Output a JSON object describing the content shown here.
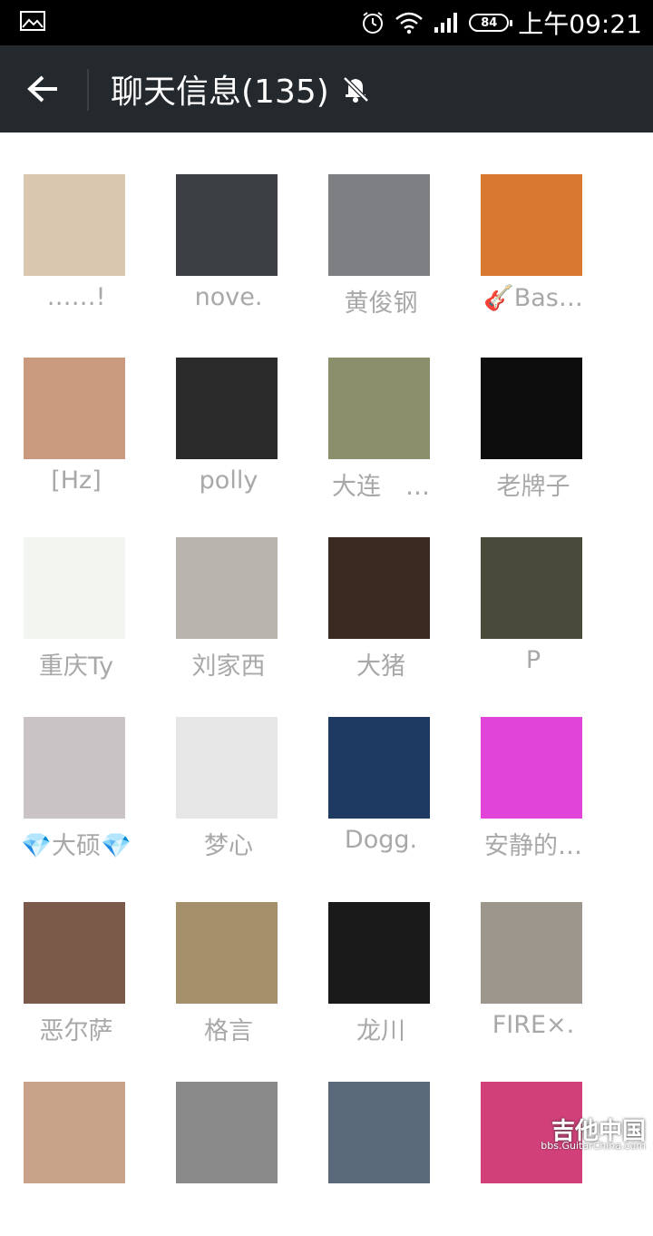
{
  "status_bar": {
    "battery": "84",
    "time": "上午09:21",
    "icons": [
      "image-icon",
      "alarm-icon",
      "wifi-icon",
      "signal-icon",
      "battery-icon"
    ]
  },
  "header": {
    "title": "聊天信息(135)",
    "back_icon": "back-arrow-icon",
    "mute_icon": "bell-muted-icon"
  },
  "members": [
    {
      "name": "……!",
      "avatar": "#d9c7b0"
    },
    {
      "name": "nove.",
      "avatar": "#3c3f44"
    },
    {
      "name": "黄俊钢",
      "avatar": "#7d7f83"
    },
    {
      "name": "🎸Bas…",
      "avatar": "#d9782f"
    },
    {
      "name": "[Hz]",
      "avatar": "#c99a7e"
    },
    {
      "name": "polly",
      "avatar": "#2b2b2b"
    },
    {
      "name": "大连　…",
      "avatar": "#8b8f6b"
    },
    {
      "name": "老牌子",
      "avatar": "#0d0d0d"
    },
    {
      "name": "重庆Ty",
      "avatar": "#f3f5f0"
    },
    {
      "name": "刘家西",
      "avatar": "#b9b4ad"
    },
    {
      "name": "大猪",
      "avatar": "#3a2a22"
    },
    {
      "name": "P",
      "avatar": "#4a4a3a"
    },
    {
      "name": "💎大硕💎",
      "avatar": "#c9c3c5"
    },
    {
      "name": "梦心",
      "avatar": "#e6e6e6"
    },
    {
      "name": "Dogg.",
      "avatar": "#1e3a63"
    },
    {
      "name": "安静的…",
      "avatar": "#e044d8"
    },
    {
      "name": "恶尔萨",
      "avatar": "#7b5a4a"
    },
    {
      "name": "格言",
      "avatar": "#a58e6a"
    },
    {
      "name": "龙川",
      "avatar": "#1a1a1a"
    },
    {
      "name": "FIRE×.",
      "avatar": "#9d968d"
    },
    {
      "name": "",
      "avatar": "#c8a38a"
    },
    {
      "name": "",
      "avatar": "#8a8a8a"
    },
    {
      "name": "",
      "avatar": "#5a6a7a"
    },
    {
      "name": "",
      "avatar": "#d2407a"
    }
  ],
  "watermark": {
    "brand": "吉他中国",
    "url": "bbs.GuitarChina.com"
  }
}
